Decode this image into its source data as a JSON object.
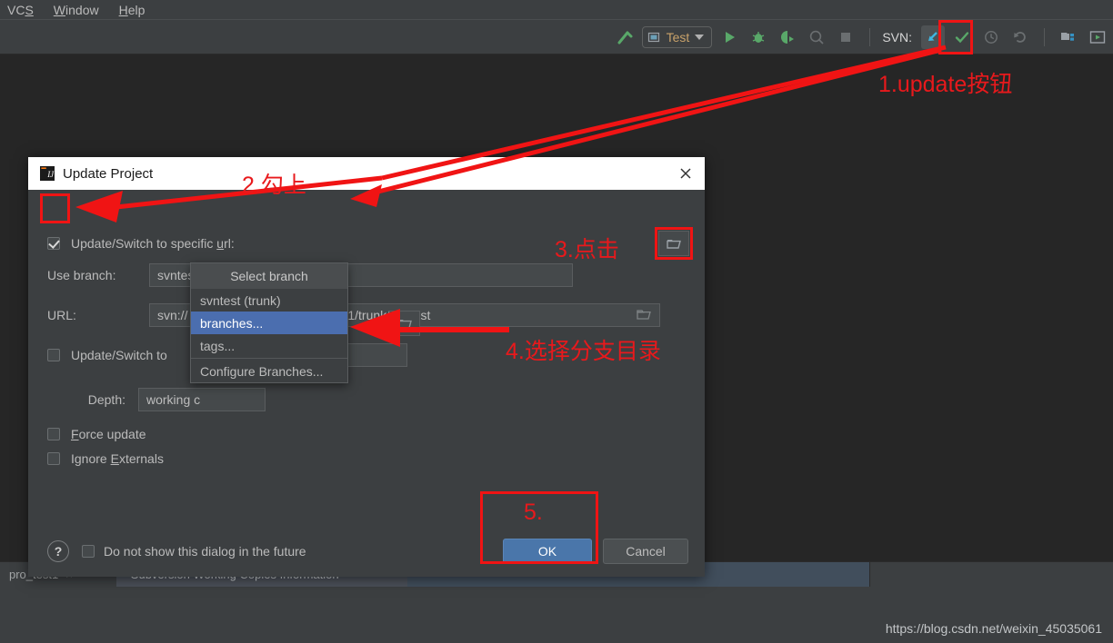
{
  "menubar": {
    "items": [
      {
        "label": "VCS",
        "mnemonic": "S"
      },
      {
        "label": "Window",
        "mnemonic": "W"
      },
      {
        "label": "Help",
        "mnemonic": "H"
      }
    ]
  },
  "toolbar": {
    "run_config_label": "Test",
    "svn_label": "SVN:",
    "icons": [
      "build-hammer-icon",
      "run-configuration-selector",
      "run-icon",
      "debug-icon",
      "run-with-coverage-icon",
      "profile-icon",
      "stop-icon",
      "svn-update-icon",
      "svn-commit-icon",
      "svn-history-icon",
      "svn-rollback-icon",
      "project-structure-icon",
      "run-anything-icon"
    ]
  },
  "dialog": {
    "title": "Update Project",
    "app_icon": "intellij-idea-icon",
    "close_icon": "close-icon",
    "specific_url": {
      "label_pre": "Update/Switch to specific ",
      "label_mnemonic": "u",
      "label_post": "rl:",
      "checked": true
    },
    "use_branch": {
      "label": "Use branch:",
      "value": "svntest",
      "browse_icon": "folder-icon"
    },
    "url": {
      "label": "URL:",
      "value_prefix": "svn://",
      "value_suffix": "t1/trunk/svntest",
      "browse_icon": "folder-icon"
    },
    "switch_second": {
      "label": "Update/Switch to",
      "value": "D",
      "checked": false,
      "browse_icon": "folder-icon"
    },
    "depth": {
      "label_pre": "",
      "label_mnemonic": "D",
      "label_post": "epth:",
      "value": "working c"
    },
    "force_update": {
      "label_pre": "",
      "label_mnemonic": "F",
      "label_post": "orce update",
      "checked": false
    },
    "ignore_externals": {
      "label_pre": "Ignore ",
      "label_mnemonic": "E",
      "label_post": "xternals",
      "checked": false
    },
    "help_glyph": "?",
    "do_not_show": {
      "label": "Do not show this dialog in the future",
      "checked": false
    },
    "ok_label": "OK",
    "cancel_label": "Cancel"
  },
  "branch_popup": {
    "header": "Select branch",
    "items": [
      {
        "label": "svntest (trunk)",
        "selected": false
      },
      {
        "label": "branches...",
        "selected": true
      },
      {
        "label": "tags...",
        "selected": false
      },
      {
        "label": "Configure Branches...",
        "selected": false
      }
    ]
  },
  "annotations": [
    {
      "id": "anno-1",
      "text": "1.update按钮"
    },
    {
      "id": "anno-2",
      "text": "2.勾上"
    },
    {
      "id": "anno-3",
      "text": "3.点击"
    },
    {
      "id": "anno-4",
      "text": "4.选择分支目录"
    },
    {
      "id": "anno-5",
      "text": "5."
    }
  ],
  "statusbar": {
    "left_tab": "pro_test1",
    "left_tab_close": "×",
    "main_tab": "Subversion Working Copies Information"
  },
  "watermark": "https://blog.csdn.net/weixin_45035061",
  "colors": {
    "accent_blue": "#4b6eaf",
    "ok_button": "#4a76aa",
    "annotation_red": "#e8191c",
    "ide_chrome": "#3c3f41",
    "editor_bg": "#262626"
  }
}
